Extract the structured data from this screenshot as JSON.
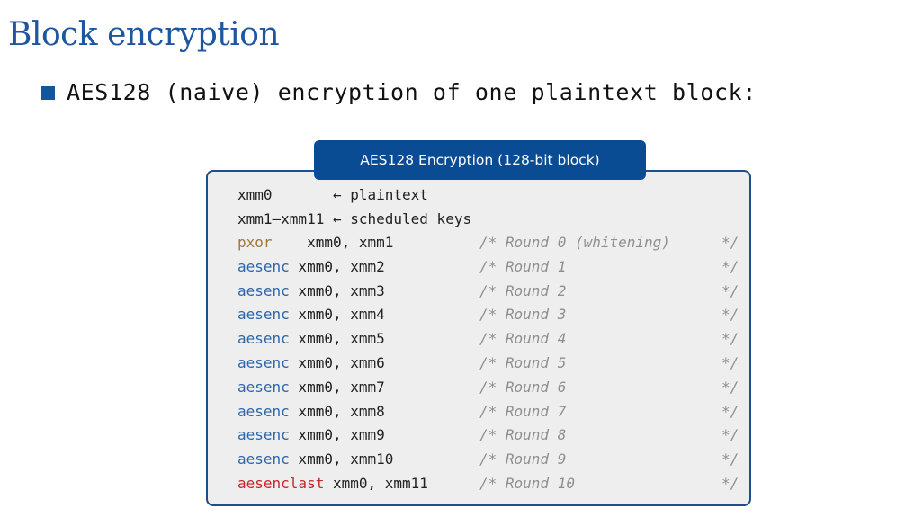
{
  "slide": {
    "title": "Block encryption",
    "bullet": "AES128 (naive) encryption of one plaintext block:"
  },
  "box": {
    "title": "AES128 Encryption (128-bit block)"
  },
  "setup_lines": [
    "xmm0       ← plaintext",
    "xmm1–xmm11 ← scheduled keys"
  ],
  "instructions": [
    {
      "op": "pxor",
      "pad": "   ",
      "args": " xmm0, xmm1",
      "comment": "/* Round 0 (whitening)",
      "end": "*/"
    },
    {
      "op": "aesenc",
      "pad": "",
      "args": " xmm0, xmm2",
      "comment": "/* Round 1",
      "end": "*/"
    },
    {
      "op": "aesenc",
      "pad": "",
      "args": " xmm0, xmm3",
      "comment": "/* Round 2",
      "end": "*/"
    },
    {
      "op": "aesenc",
      "pad": "",
      "args": " xmm0, xmm4",
      "comment": "/* Round 3",
      "end": "*/"
    },
    {
      "op": "aesenc",
      "pad": "",
      "args": " xmm0, xmm5",
      "comment": "/* Round 4",
      "end": "*/"
    },
    {
      "op": "aesenc",
      "pad": "",
      "args": " xmm0, xmm6",
      "comment": "/* Round 5",
      "end": "*/"
    },
    {
      "op": "aesenc",
      "pad": "",
      "args": " xmm0, xmm7",
      "comment": "/* Round 6",
      "end": "*/"
    },
    {
      "op": "aesenc",
      "pad": "",
      "args": " xmm0, xmm8",
      "comment": "/* Round 7",
      "end": "*/"
    },
    {
      "op": "aesenc",
      "pad": "",
      "args": " xmm0, xmm9",
      "comment": "/* Round 8",
      "end": "*/"
    },
    {
      "op": "aesenc",
      "pad": "",
      "args": " xmm0, xmm10",
      "comment": "/* Round 9",
      "end": "*/"
    },
    {
      "op": "aesenclast",
      "pad": "",
      "args": " xmm0, xmm11",
      "comment": "/* Round 10",
      "end": "*/"
    }
  ],
  "colors": {
    "title": "#1e56a0",
    "bullet": "#12569e",
    "box_border": "#1e4d8c",
    "box_bg": "#eeeeee",
    "tab_bg": "#0a4c93",
    "pxor": "#a0773b",
    "aesenc": "#2e66a8",
    "aesenclast": "#c8242a",
    "comment": "#8f8f8f"
  }
}
